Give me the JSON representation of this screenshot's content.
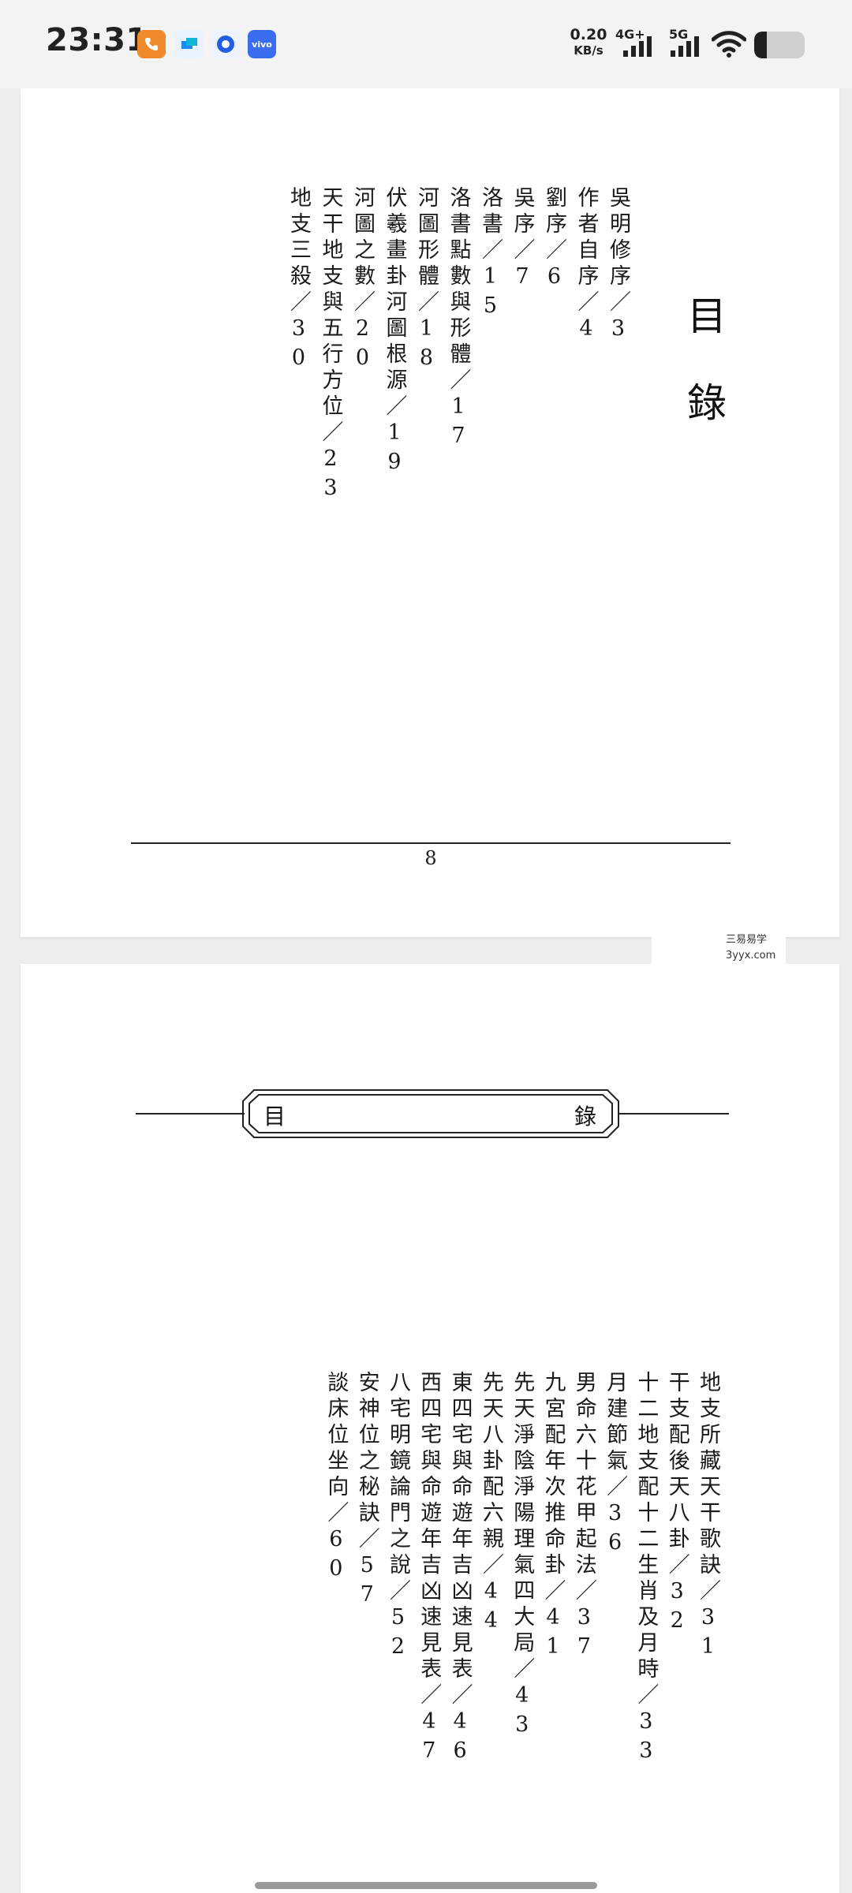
{
  "status_bar": {
    "time": "23:31",
    "net_speed_value": "0.20",
    "net_speed_unit": "KB/s",
    "network_1": "4G+",
    "network_2": "5G",
    "battery_level": 0.25,
    "vivo_label": "vivo"
  },
  "page1": {
    "title": "目錄",
    "entries": [
      "吳明修序／3",
      "作者自序／4",
      "劉序／6",
      "吳序／7",
      "洛書／15",
      "洛書點數與形體／17",
      "河圖形體／18",
      "伏羲畫卦河圖根源／19",
      "河圖之數／20",
      "天干地支與五行方位／23",
      "地支三殺／30"
    ],
    "page_number": "8"
  },
  "watermark": {
    "line1": "三易易学",
    "line2": "3yyx.com"
  },
  "page2": {
    "banner_left": "目",
    "banner_right": "錄",
    "entries": [
      "地支所藏天干歌訣／31",
      "干支配後天八卦／32",
      "十二地支配十二生肖及月時／33",
      "月建節氣／36",
      "男命六十花甲起法／37",
      "九宮配年次推命卦／41",
      "先天淨陰淨陽理氣四大局／43",
      "先天八卦配六親／44",
      "東四宅與命遊年吉凶速見表／46",
      "西四宅與命遊年吉凶速見表／47",
      "八宅明鏡論門之說／52",
      "安神位之秘訣／57",
      "談床位坐向／60"
    ]
  }
}
